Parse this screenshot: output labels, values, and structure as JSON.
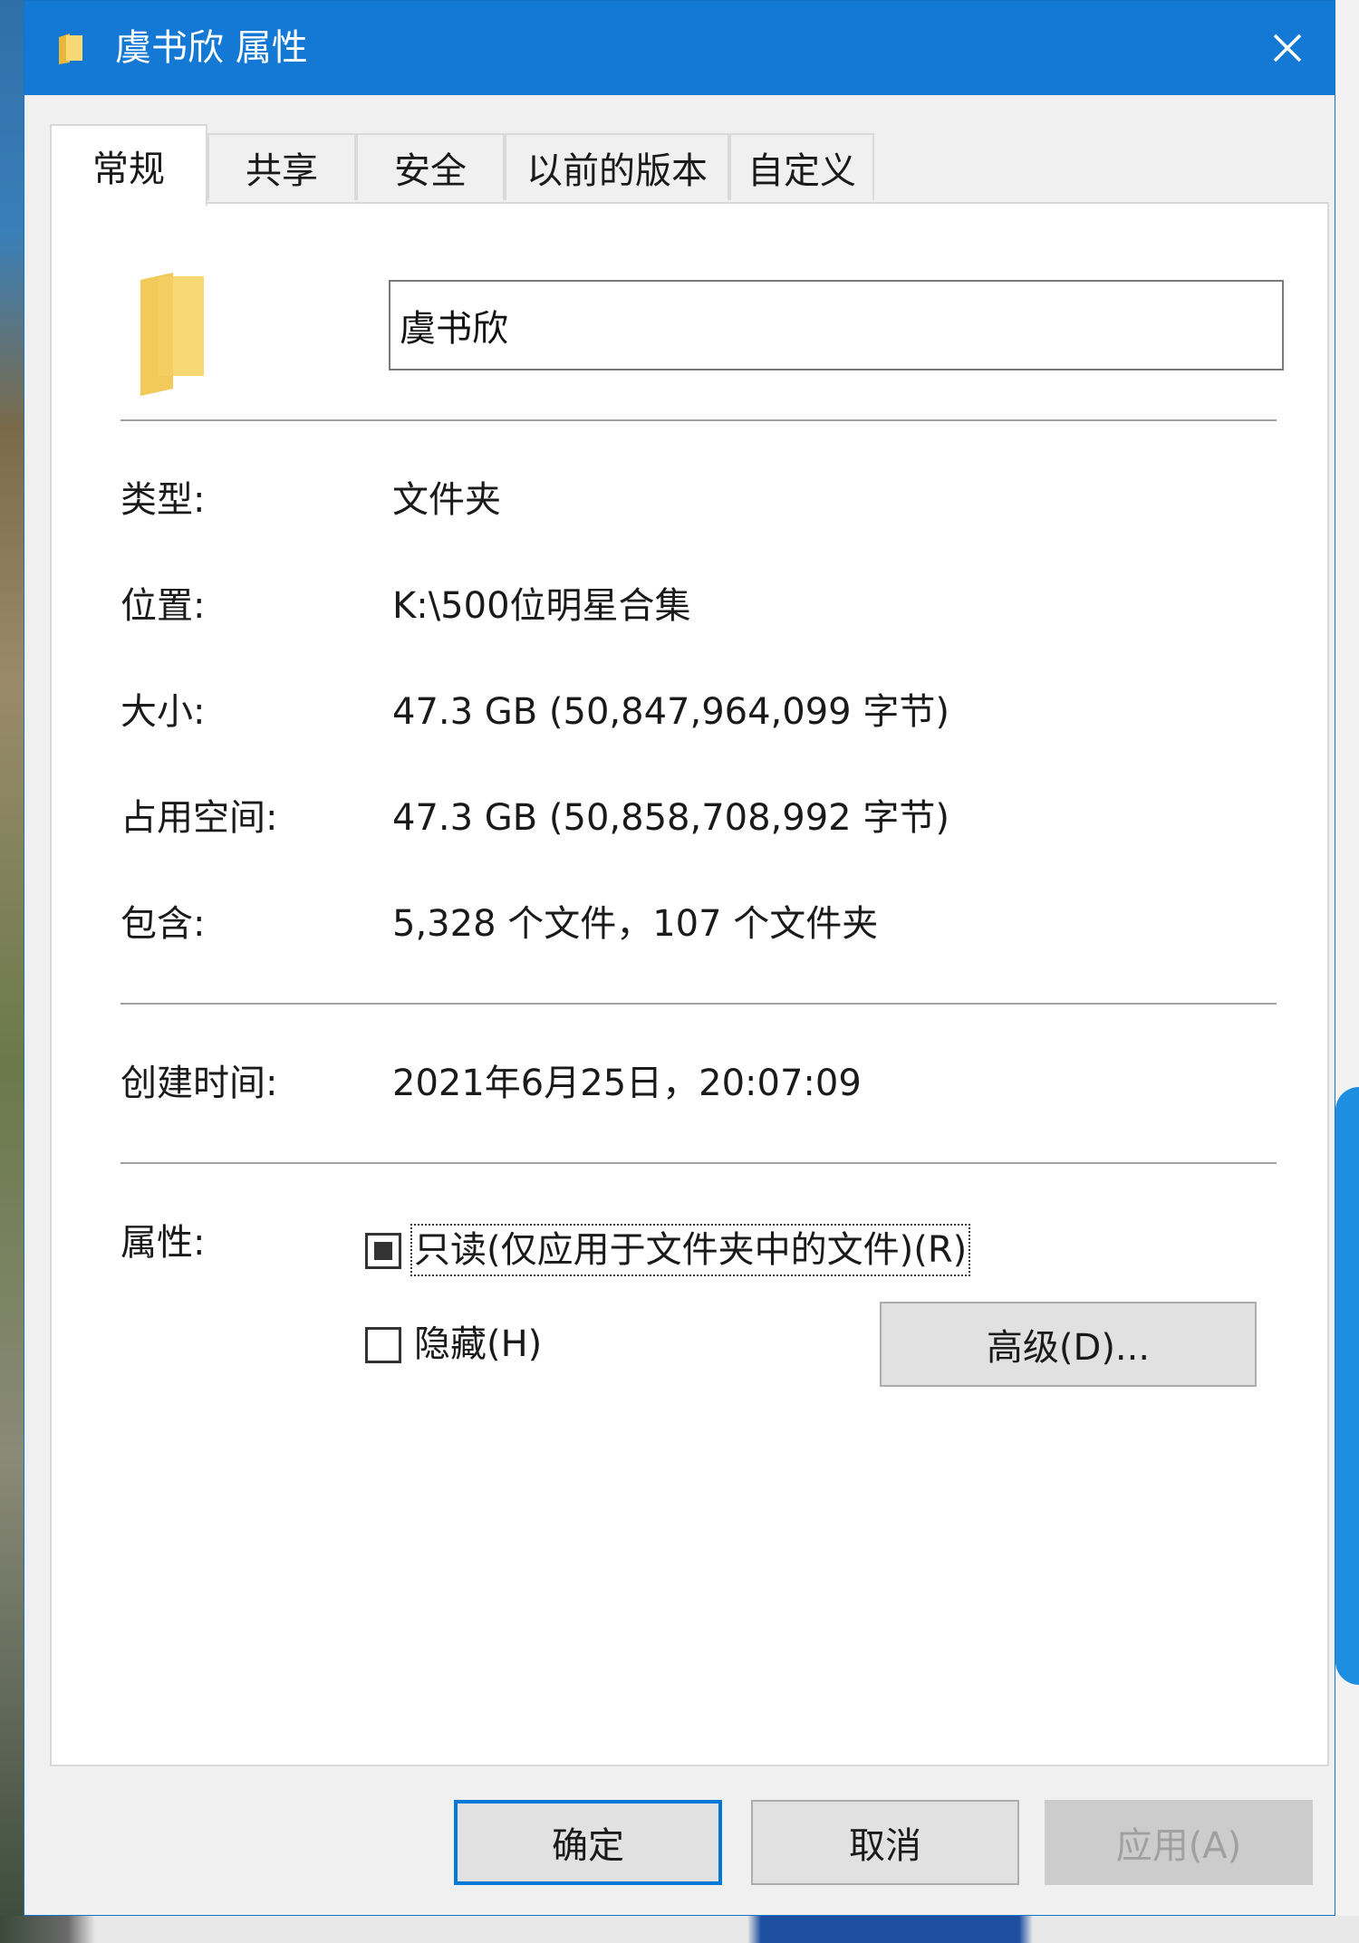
{
  "window": {
    "title": "虞书欣 属性",
    "close_icon": "close-icon"
  },
  "tabs": [
    {
      "label": "常规",
      "active": true
    },
    {
      "label": "共享",
      "active": false
    },
    {
      "label": "安全",
      "active": false
    },
    {
      "label": "以前的版本",
      "active": false
    },
    {
      "label": "自定义",
      "active": false
    }
  ],
  "general": {
    "folder_name": "虞书欣",
    "rows": [
      {
        "label": "类型:",
        "value": "文件夹"
      },
      {
        "label": "位置:",
        "value": "K:\\500位明星合集"
      },
      {
        "label": "大小:",
        "value": "47.3 GB (50,847,964,099 字节)"
      },
      {
        "label": "占用空间:",
        "value": "47.3 GB (50,858,708,992 字节)"
      },
      {
        "label": "包含:",
        "value": "5,328 个文件，107 个文件夹"
      }
    ],
    "created": {
      "label": "创建时间:",
      "value": "2021年6月25日，20:07:09"
    },
    "attributes": {
      "label": "属性:",
      "readonly": {
        "label": "只读(仅应用于文件夹中的文件)(R)",
        "state": "indeterminate"
      },
      "hidden": {
        "label": "隐藏(H)",
        "state": "unchecked"
      },
      "advanced_button": "高级(D)..."
    }
  },
  "footer": {
    "ok": "确定",
    "cancel": "取消",
    "apply": "应用(A)"
  },
  "colors": {
    "titlebar": "#1479d4",
    "folder": "#f8d775",
    "default_button_border": "#0078d7"
  }
}
